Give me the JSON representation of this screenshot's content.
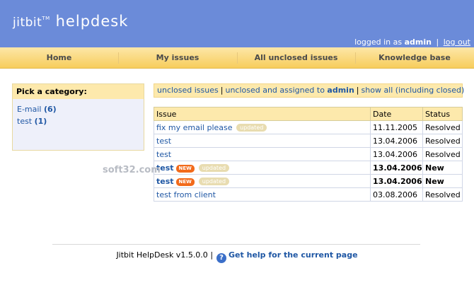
{
  "header": {
    "logo_prefix": "jitbit",
    "logo_tm": "TM",
    "logo_main": "helpdesk",
    "logged_in_text": "logged in as",
    "user": "admin",
    "separator": "|",
    "logout_label": "log out"
  },
  "nav": {
    "items": [
      {
        "label": "Home"
      },
      {
        "label": "My issues"
      },
      {
        "label": "All unclosed issues"
      },
      {
        "label": "Knowledge base"
      }
    ]
  },
  "categories": {
    "title": "Pick a category:",
    "items": [
      {
        "name": "E-mail",
        "count": "(6)"
      },
      {
        "name": "test",
        "count": "(1)"
      }
    ]
  },
  "filters": {
    "unclosed": "unclosed issues",
    "assigned_prefix": "unclosed and assigned to",
    "assigned_user": "admin",
    "show_all": "show all (including closed)",
    "separator": "|"
  },
  "issues": {
    "columns": [
      "Issue",
      "Date",
      "Status"
    ],
    "rows": [
      {
        "title": "fix my email please",
        "new": "",
        "updated": "updated",
        "date": "11.11.2005",
        "status": "Resolved"
      },
      {
        "title": "test",
        "new": "",
        "updated": "",
        "date": "13.04.2006",
        "status": "Resolved"
      },
      {
        "title": "test",
        "new": "",
        "updated": "",
        "date": "13.04.2006",
        "status": "Resolved"
      },
      {
        "title": "test",
        "new": "NEW",
        "updated": "updated",
        "date": "13.04.2006",
        "status": "New"
      },
      {
        "title": "test",
        "new": "NEW",
        "updated": "updated",
        "date": "13.04.2006",
        "status": "New"
      },
      {
        "title": "test from client",
        "new": "",
        "updated": "",
        "date": "03.08.2006",
        "status": "Resolved"
      }
    ]
  },
  "watermark": "soft32.com",
  "footer": {
    "version": "Jitbit HelpDesk v1.5.0.0",
    "separator": "|",
    "help_icon": "?",
    "help_label": "Get help for the current page"
  },
  "colors": {
    "header_bg": "#6b8bd9",
    "nav_bg": "#f7cd5c",
    "link": "#1f57a4",
    "new_badge": "#f26a1b"
  }
}
